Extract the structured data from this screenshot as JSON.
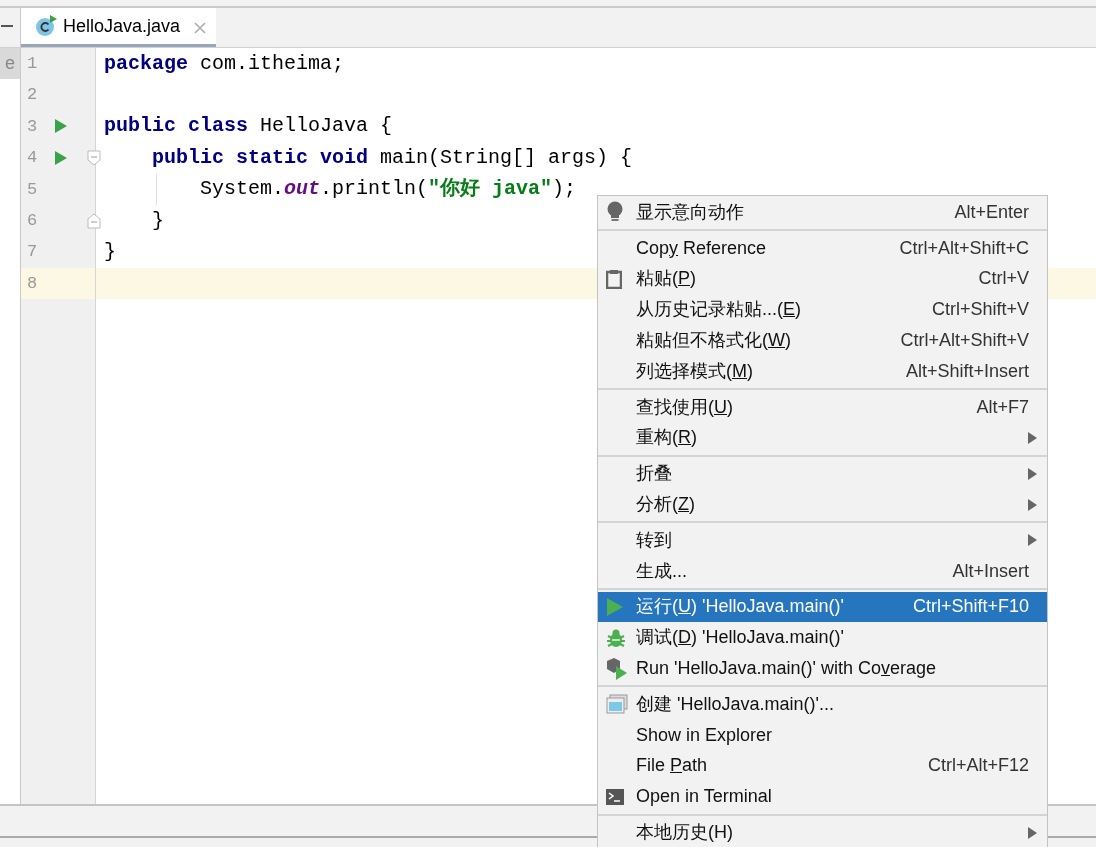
{
  "side_panel": {
    "item_text": "e"
  },
  "tabs": [
    {
      "label": "HelloJava.java",
      "selected": true
    }
  ],
  "editor": {
    "lines": [
      {
        "number": "1",
        "runnable": false,
        "current": false,
        "fold_start": false,
        "fold_end": false,
        "tokens": [
          {
            "text": "package",
            "kind": "keyword"
          },
          {
            "text": " com.itheima;",
            "kind": "plain"
          }
        ]
      },
      {
        "number": "2",
        "runnable": false,
        "current": false,
        "fold_start": false,
        "fold_end": false
      },
      {
        "number": "3",
        "runnable": true,
        "current": false,
        "fold_start": false,
        "fold_end": false,
        "tokens": [
          {
            "text": "public class",
            "kind": "keyword"
          },
          {
            "text": " HelloJava {",
            "kind": "plain"
          }
        ]
      },
      {
        "number": "4",
        "runnable": true,
        "current": false,
        "fold_start": true,
        "fold_end": false,
        "tokens": [
          {
            "text": "    public static void",
            "kind": "keyword"
          },
          {
            "text": " main(String[] args) {",
            "kind": "plain"
          }
        ]
      },
      {
        "number": "5",
        "runnable": false,
        "current": false,
        "fold_start": false,
        "fold_end": false,
        "tokens": [
          {
            "text": "        System.",
            "kind": "plain"
          },
          {
            "text": "out",
            "kind": "field"
          },
          {
            "text": ".println(",
            "kind": "plain"
          },
          {
            "text": "\"你好 java\"",
            "kind": "string"
          },
          {
            "text": ");",
            "kind": "plain"
          }
        ]
      },
      {
        "number": "6",
        "runnable": false,
        "current": false,
        "fold_start": false,
        "fold_end": true,
        "tokens": [
          {
            "text": "    }",
            "kind": "plain"
          }
        ]
      },
      {
        "number": "7",
        "runnable": false,
        "current": false,
        "fold_start": false,
        "fold_end": false,
        "tokens": [
          {
            "text": "}",
            "kind": "plain"
          }
        ]
      },
      {
        "number": "8",
        "runnable": false,
        "current": true,
        "fold_start": false,
        "fold_end": false
      }
    ]
  },
  "context_menu": {
    "groups": [
      [
        {
          "label_parts": [
            "显示意向动作"
          ],
          "shortcut": "Alt+Enter",
          "submenu": false,
          "selected": false
        }
      ],
      [
        {
          "label_parts": [
            "Cop",
            "y",
            " Reference"
          ],
          "shortcut": "Ctrl+Alt+Shift+C",
          "submenu": false,
          "selected": false
        },
        {
          "label_parts": [
            "粘贴(",
            "P",
            ")"
          ],
          "shortcut": "Ctrl+V",
          "submenu": false,
          "selected": false
        },
        {
          "label_parts": [
            "从历史记录粘贴...(",
            "E",
            ")"
          ],
          "shortcut": "Ctrl+Shift+V",
          "submenu": false,
          "selected": false
        },
        {
          "label_parts": [
            "粘贴但不格式化(",
            "W",
            ")"
          ],
          "shortcut": "Ctrl+Alt+Shift+V",
          "submenu": false,
          "selected": false
        },
        {
          "label_parts": [
            "列选择模式(",
            "M",
            ")"
          ],
          "shortcut": "Alt+Shift+Insert",
          "submenu": false,
          "selected": false
        }
      ],
      [
        {
          "label_parts": [
            "查找使用(",
            "U",
            ")"
          ],
          "shortcut": "Alt+F7",
          "submenu": false,
          "selected": false
        },
        {
          "label_parts": [
            "重构(",
            "R",
            ")"
          ],
          "submenu": true,
          "selected": false
        }
      ],
      [
        {
          "label_parts": [
            "折叠"
          ],
          "submenu": true,
          "selected": false
        },
        {
          "label_parts": [
            "分析(",
            "Z",
            ")"
          ],
          "submenu": true,
          "selected": false
        }
      ],
      [
        {
          "label_parts": [
            "转到"
          ],
          "submenu": true,
          "selected": false
        },
        {
          "label_parts": [
            "生成..."
          ],
          "shortcut": "Alt+Insert",
          "submenu": false,
          "selected": false
        }
      ],
      [
        {
          "label_parts": [
            "运行(",
            "U",
            ") 'HelloJava.main()'"
          ],
          "shortcut": "Ctrl+Shift+F10",
          "submenu": false,
          "selected": true
        },
        {
          "label_parts": [
            "调试(",
            "D",
            ") 'HelloJava.main()'"
          ],
          "submenu": false,
          "selected": false
        },
        {
          "label_parts": [
            "Run 'HelloJava.main()' with Co",
            "v",
            "erage"
          ],
          "submenu": false,
          "selected": false
        }
      ],
      [
        {
          "label_parts": [
            "创建 'HelloJava.main()'..."
          ],
          "submenu": false,
          "selected": false
        },
        {
          "label_parts": [
            "Show in Explorer"
          ],
          "submenu": false,
          "selected": false
        },
        {
          "label_parts": [
            "File ",
            "P",
            "ath"
          ],
          "shortcut": "Ctrl+Alt+F12",
          "submenu": false,
          "selected": false
        },
        {
          "label_parts": [
            "Open in Terminal"
          ],
          "submenu": false,
          "selected": false
        }
      ],
      [
        {
          "label_parts": [
            "本地历史(H)"
          ],
          "submenu": true,
          "selected": false
        }
      ]
    ]
  }
}
